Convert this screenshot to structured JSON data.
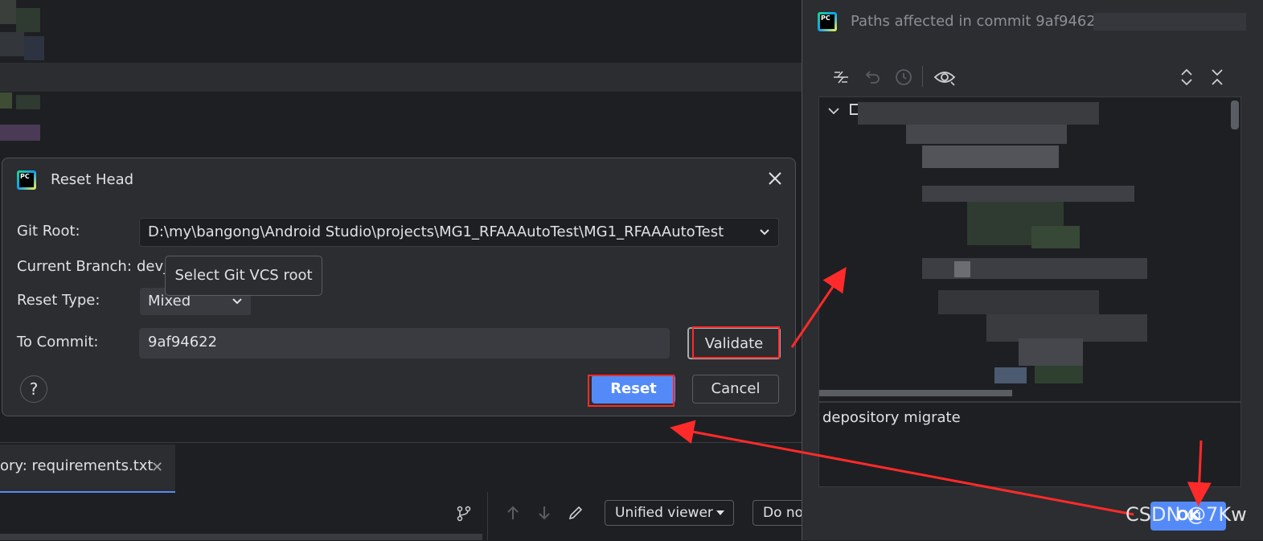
{
  "dialog": {
    "title": "Reset Head",
    "git_root_label": "Git Root:",
    "git_root_value": "D:\\my\\bangong\\Android Studio\\projects\\MG1_RFAAAutoTest\\MG1_RFAAAutoTest",
    "current_branch_label": "Current Branch:",
    "current_branch_value": "dev_",
    "reset_type_label": "Reset Type:",
    "reset_type_value": "Mixed",
    "to_commit_label": "To Commit:",
    "to_commit_value": "9af94622",
    "validate_label": "Validate",
    "reset_label": "Reset",
    "cancel_label": "Cancel",
    "help_label": "?",
    "tooltip": "Select Git VCS root"
  },
  "bottom": {
    "tab_label": "ory: requirements.txt",
    "tab_close": "✕",
    "viewer_label": "Unified viewer",
    "ignore_label": "Do no"
  },
  "right_panel": {
    "title": "Paths affected in commit 9af94622",
    "commit_message": "depository migrate",
    "ok_label": "OK"
  },
  "watermark": "CSDN @7Kw",
  "colors": {
    "accent": "#548af7",
    "annotation": "#ff2a2a",
    "background": "#1e1f22",
    "panel": "#2b2d30"
  }
}
